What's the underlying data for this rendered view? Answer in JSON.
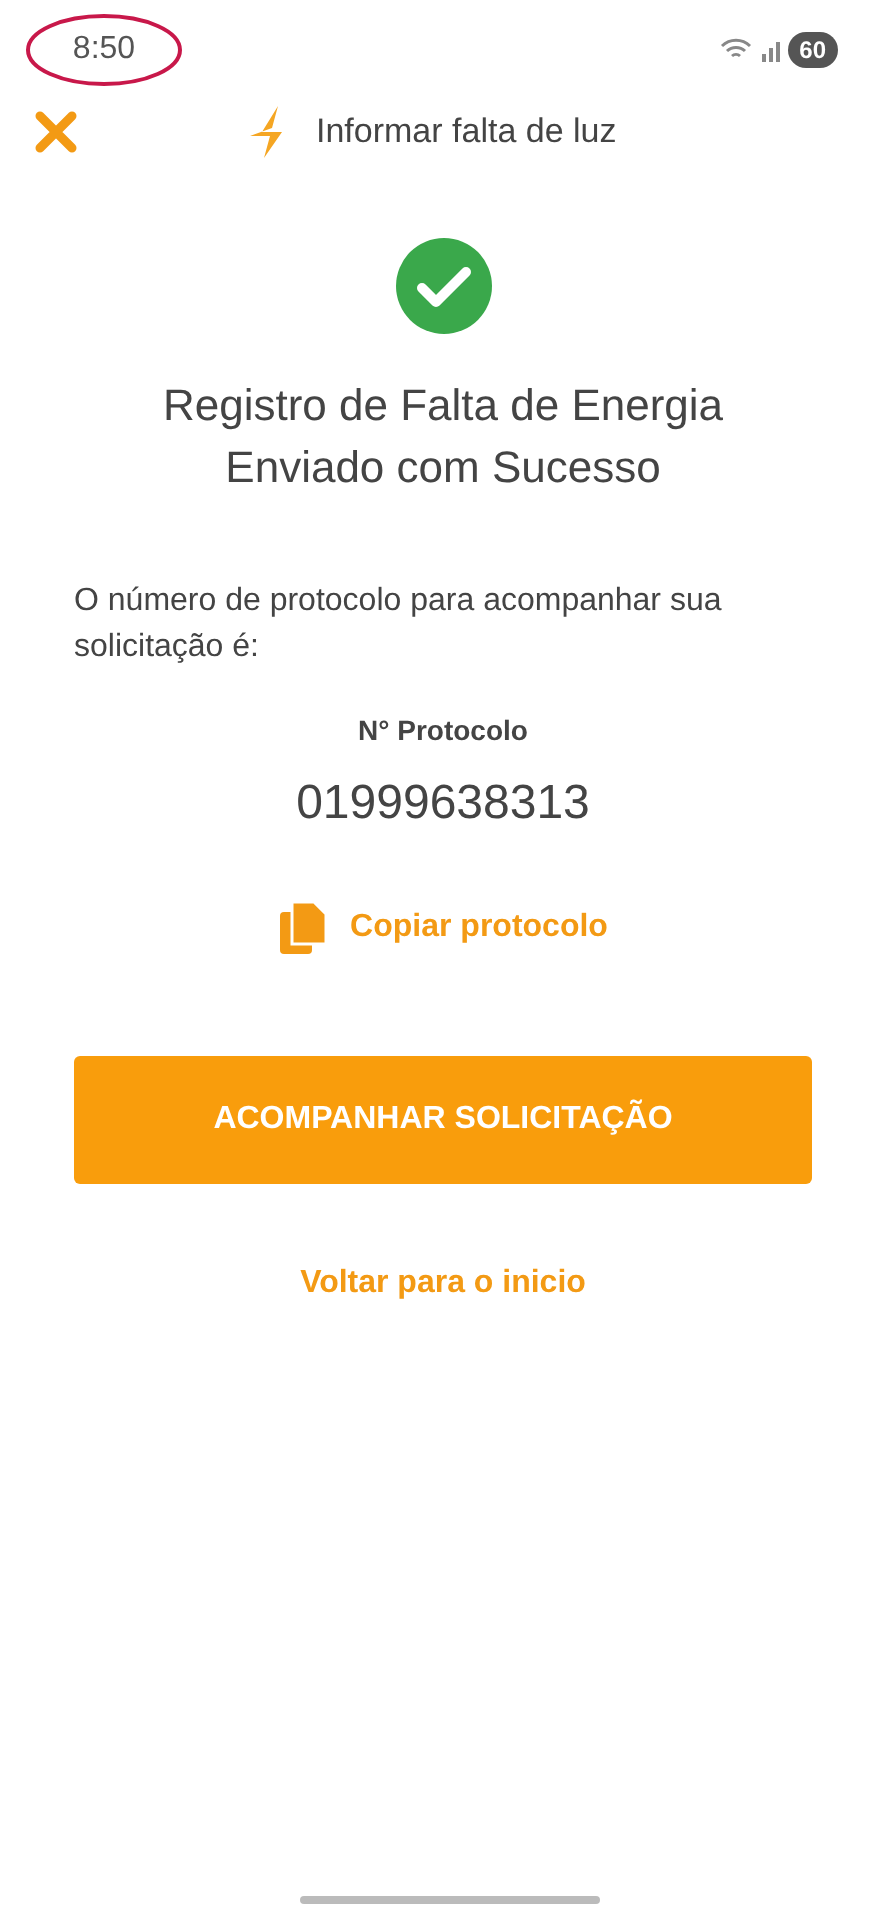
{
  "status_bar": {
    "time": "8:50",
    "battery": "60"
  },
  "header": {
    "title": "Informar falta de luz"
  },
  "success": {
    "title": "Registro de Falta de Energia Enviado com Sucesso",
    "message": "O número de protocolo para acompanhar sua solicitação é:"
  },
  "protocol": {
    "label": "N° Protocolo",
    "number": "01999638313",
    "copy_label": "Copiar protocolo"
  },
  "primary_button": "ACOMPANHAR SOLICITAÇÃO",
  "back_link": "Voltar para o inicio"
}
